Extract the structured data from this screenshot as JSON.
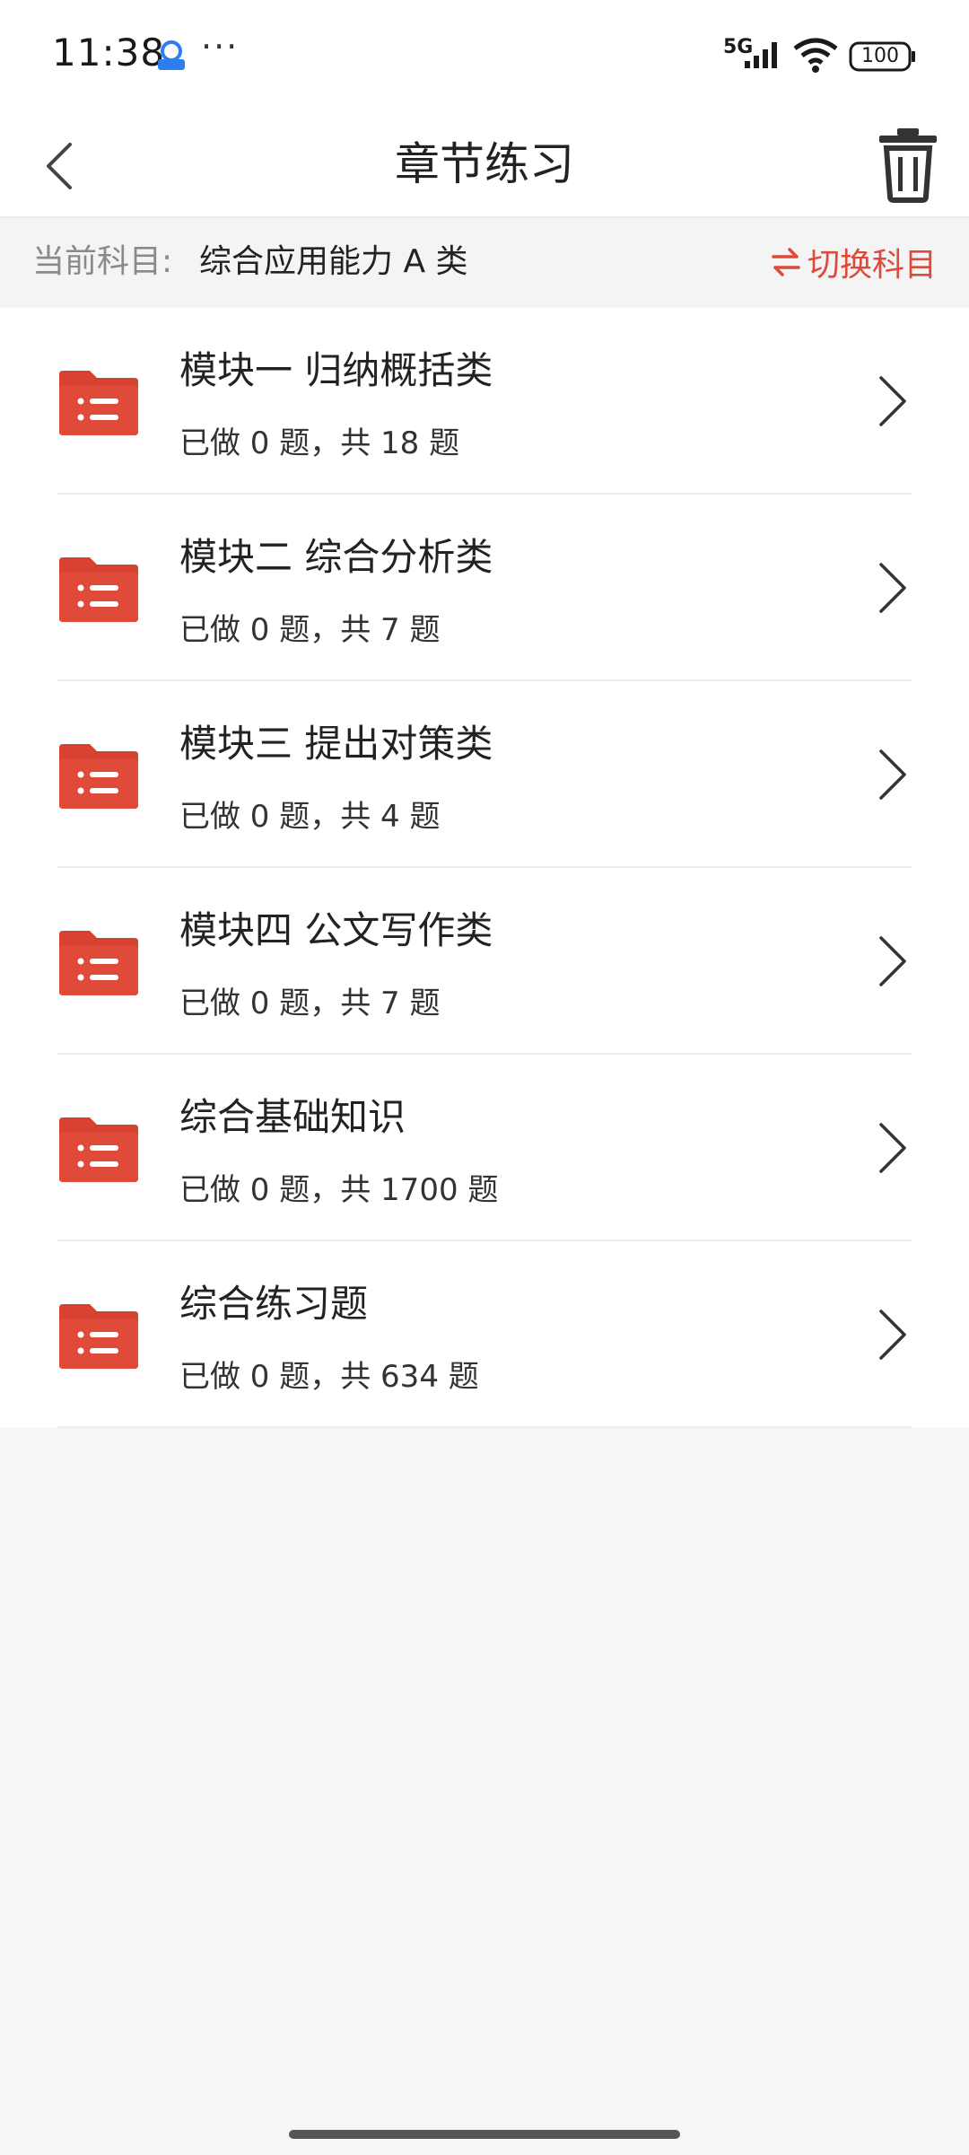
{
  "status_bar": {
    "time": "11:38",
    "more": "···",
    "network": "5G",
    "battery": "100"
  },
  "nav": {
    "title": "章节练习",
    "back_icon": "chevron-left-icon",
    "trash_icon": "trash-icon"
  },
  "subject": {
    "label": "当前科目:",
    "value": "综合应用能力 A 类",
    "switch_label": "切换科目"
  },
  "chapters": [
    {
      "title": "模块一 归纳概括类",
      "progress": "已做 0 题，共 18 题"
    },
    {
      "title": "模块二 综合分析类",
      "progress": "已做 0 题，共 7 题"
    },
    {
      "title": "模块三 提出对策类",
      "progress": "已做 0 题，共 4 题"
    },
    {
      "title": "模块四 公文写作类",
      "progress": "已做 0 题，共 7 题"
    },
    {
      "title": "综合基础知识",
      "progress": "已做 0 题，共 1700 题"
    },
    {
      "title": "综合练习题",
      "progress": "已做 0 题，共 634 题"
    }
  ],
  "colors": {
    "accent": "#dd4a3a",
    "background": "#f6f6f6"
  }
}
